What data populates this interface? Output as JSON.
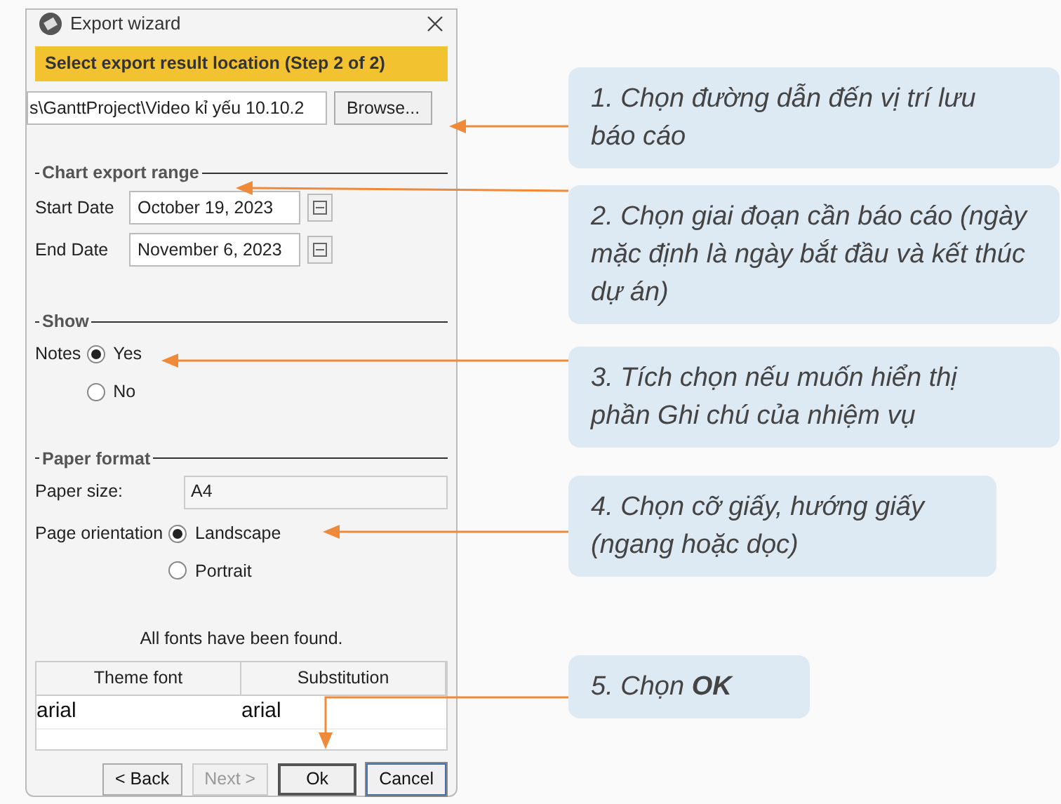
{
  "window": {
    "title": "Export wizard"
  },
  "step_header": "Select export result location (Step 2 of 2)",
  "path_field": {
    "value": "s\\GanttProject\\Video kỉ yếu 10.10.2"
  },
  "browse_button": "Browse...",
  "chart_export_range": {
    "title": "Chart export range",
    "start_date": {
      "label": "Start Date",
      "value": "October 19, 2023"
    },
    "end_date": {
      "label": "End Date",
      "value": "November 6, 2023"
    }
  },
  "show": {
    "title": "Show",
    "label": "Notes",
    "options": [
      {
        "label": "Yes",
        "selected": true
      },
      {
        "label": "No",
        "selected": false
      }
    ]
  },
  "paper_format": {
    "title": "Paper format",
    "paper_size": {
      "label": "Paper size:",
      "value": "A4"
    },
    "orientation": {
      "label": "Page orientation",
      "options": [
        {
          "label": "Landscape",
          "selected": true
        },
        {
          "label": "Portrait",
          "selected": false
        }
      ]
    }
  },
  "fonts": {
    "message": "All fonts have been found.",
    "columns": [
      "Theme font",
      "Substitution"
    ],
    "rows": [
      [
        "arial",
        "arial"
      ]
    ]
  },
  "buttons": [
    {
      "label": "< Back",
      "disabled": false,
      "default": false,
      "focused": false
    },
    {
      "label": "Next >",
      "disabled": true,
      "default": false,
      "focused": false
    },
    {
      "label": "Ok",
      "disabled": false,
      "default": true,
      "focused": false
    },
    {
      "label": "Cancel",
      "disabled": false,
      "default": false,
      "focused": true
    }
  ],
  "callouts": [
    {
      "text": "1. Chọn đường dẫn đến vị trí lưu báo cáo"
    },
    {
      "text": "2. Chọn giai đoạn cần báo cáo (ngày mặc định là ngày bắt đầu và kết thúc dự án)"
    },
    {
      "text": "3. Tích chọn nếu muốn hiển thị phần Ghi chú của nhiệm vụ"
    },
    {
      "text": "4. Chọn cỡ giấy, hướng giấy (ngang hoặc dọc)"
    },
    {
      "text": "5. Chọn **OK**"
    }
  ]
}
